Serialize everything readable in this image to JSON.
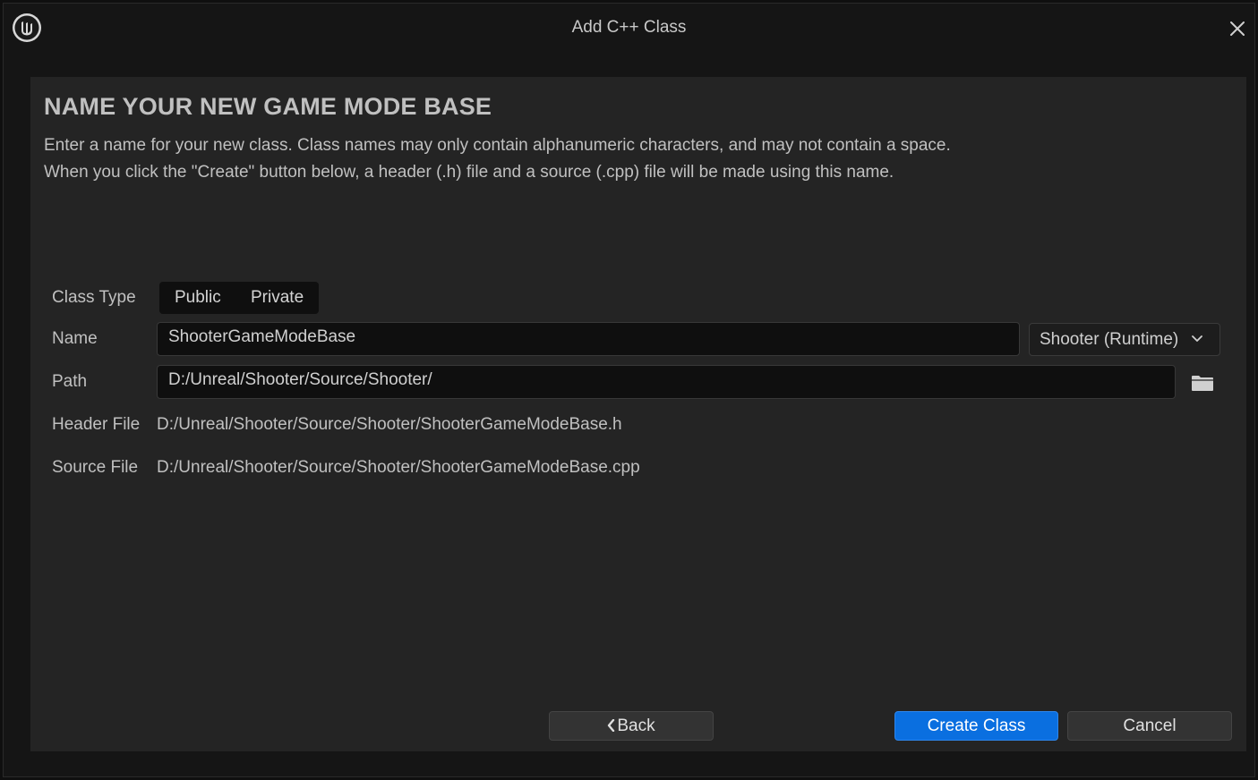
{
  "window": {
    "title": "Add C++ Class"
  },
  "page": {
    "heading": "NAME YOUR NEW GAME MODE BASE",
    "description_line1": "Enter a name for your new class. Class names may only contain alphanumeric characters, and may not contain a space.",
    "description_line2": "When you click the \"Create\" button below, a header (.h) file and a source (.cpp) file will be made using this name."
  },
  "form": {
    "class_type_label": "Class Type",
    "class_type_options": [
      "Public",
      "Private"
    ],
    "name_label": "Name",
    "name_value": "ShooterGameModeBase",
    "module_selected": "Shooter (Runtime)",
    "path_label": "Path",
    "path_value": "D:/Unreal/Shooter/Source/Shooter/",
    "header_file_label": "Header File",
    "header_file_value": "D:/Unreal/Shooter/Source/Shooter/ShooterGameModeBase.h",
    "source_file_label": "Source File",
    "source_file_value": "D:/Unreal/Shooter/Source/Shooter/ShooterGameModeBase.cpp"
  },
  "buttons": {
    "back": "Back",
    "create": "Create Class",
    "cancel": "Cancel"
  },
  "icons": {
    "logo": "unreal-logo-icon",
    "close": "close-icon",
    "folder": "folder-icon",
    "dropdown": "chevron-down-icon",
    "back": "chevron-left-icon"
  },
  "colors": {
    "accent": "#0a6fe0",
    "panel": "#242424",
    "background": "#151515"
  }
}
